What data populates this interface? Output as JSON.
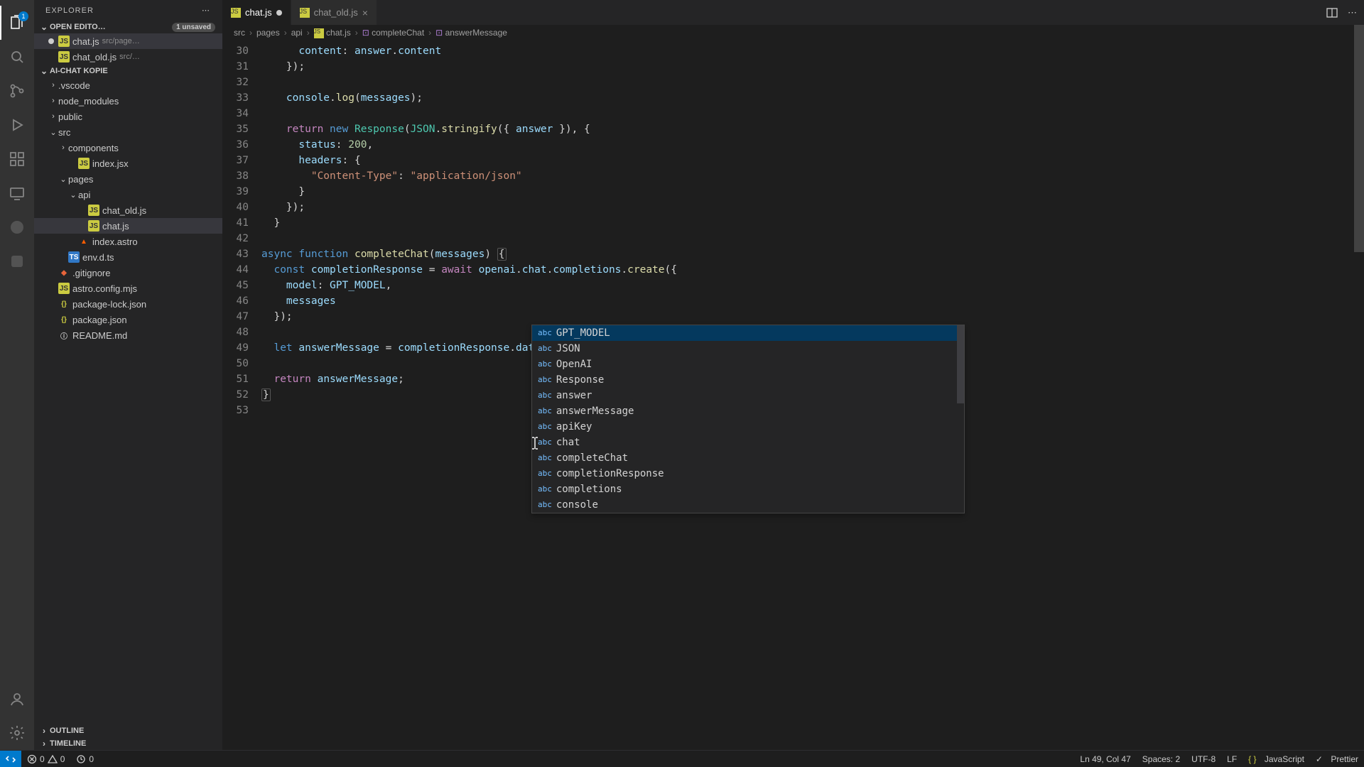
{
  "activity_bar": {
    "badge": "1"
  },
  "sidebar": {
    "title": "EXPLORER",
    "open_editors": {
      "label": "OPEN EDITO…",
      "unsaved": "1 unsaved"
    },
    "editors": [
      {
        "name": "chat.js",
        "hint": "src/page…",
        "modified": true
      },
      {
        "name": "chat_old.js",
        "hint": "src/…",
        "modified": false
      }
    ],
    "project": "AI-CHAT KOPIE",
    "tree": [
      {
        "indent": 1,
        "type": "folder",
        "open": false,
        "name": ".vscode"
      },
      {
        "indent": 1,
        "type": "folder",
        "open": false,
        "name": "node_modules"
      },
      {
        "indent": 1,
        "type": "folder",
        "open": false,
        "name": "public"
      },
      {
        "indent": 1,
        "type": "folder",
        "open": true,
        "name": "src"
      },
      {
        "indent": 2,
        "type": "folder",
        "open": false,
        "name": "components"
      },
      {
        "indent": 3,
        "type": "file",
        "icon": "js",
        "name": "index.jsx"
      },
      {
        "indent": 2,
        "type": "folder",
        "open": true,
        "name": "pages"
      },
      {
        "indent": 3,
        "type": "folder",
        "open": true,
        "name": "api"
      },
      {
        "indent": 4,
        "type": "file",
        "icon": "js",
        "name": "chat_old.js"
      },
      {
        "indent": 4,
        "type": "file",
        "icon": "js",
        "name": "chat.js",
        "active": true
      },
      {
        "indent": 3,
        "type": "file",
        "icon": "astro",
        "name": "index.astro"
      },
      {
        "indent": 2,
        "type": "file",
        "icon": "ts",
        "name": "env.d.ts"
      },
      {
        "indent": 1,
        "type": "file",
        "icon": "git",
        "name": ".gitignore"
      },
      {
        "indent": 1,
        "type": "file",
        "icon": "js",
        "name": "astro.config.mjs"
      },
      {
        "indent": 1,
        "type": "file",
        "icon": "braces",
        "name": "package-lock.json"
      },
      {
        "indent": 1,
        "type": "file",
        "icon": "braces",
        "name": "package.json"
      },
      {
        "indent": 1,
        "type": "file",
        "icon": "info",
        "name": "README.md"
      }
    ],
    "outline": "OUTLINE",
    "timeline": "TIMELINE"
  },
  "tabs": [
    {
      "name": "chat.js",
      "active": true,
      "modified": true
    },
    {
      "name": "chat_old.js",
      "active": false,
      "modified": false
    }
  ],
  "breadcrumb": [
    "src",
    "pages",
    "api",
    "chat.js",
    "completeChat",
    "answerMessage"
  ],
  "lines": {
    "start": 30,
    "end": 53,
    "30": "      content: answer.content",
    "31": "    });",
    "32": "",
    "33": "    console.log(messages);",
    "34": "",
    "35": "    return new Response(JSON.stringify({ answer }), {",
    "36": "      status: 200,",
    "37": "      headers: {",
    "38": "        \"Content-Type\": \"application/json\"",
    "39": "      }",
    "40": "    });",
    "41": "  }",
    "42": "",
    "43": "async function completeChat(messages) {",
    "44": "  const completionResponse = await openai.chat.completions.create({",
    "45": "    model: GPT_MODEL,",
    "46": "    messages",
    "47": "  });",
    "48": "",
    "49": "  let answerMessage = completionResponse.data.choices[0].message;",
    "50": "",
    "51": "  return answerMessage;",
    "52": "}",
    "53": ""
  },
  "suggestions": [
    "GPT_MODEL",
    "JSON",
    "OpenAI",
    "Response",
    "answer",
    "answerMessage",
    "apiKey",
    "chat",
    "completeChat",
    "completionResponse",
    "completions",
    "console"
  ],
  "suggest_kind": "abc",
  "statusbar": {
    "errors": "0",
    "warnings": "0",
    "ports": "0",
    "ln_col": "Ln 49, Col 47",
    "spaces": "Spaces: 2",
    "encoding": "UTF-8",
    "eol": "LF",
    "lang": "JavaScript",
    "prettier": "Prettier"
  }
}
